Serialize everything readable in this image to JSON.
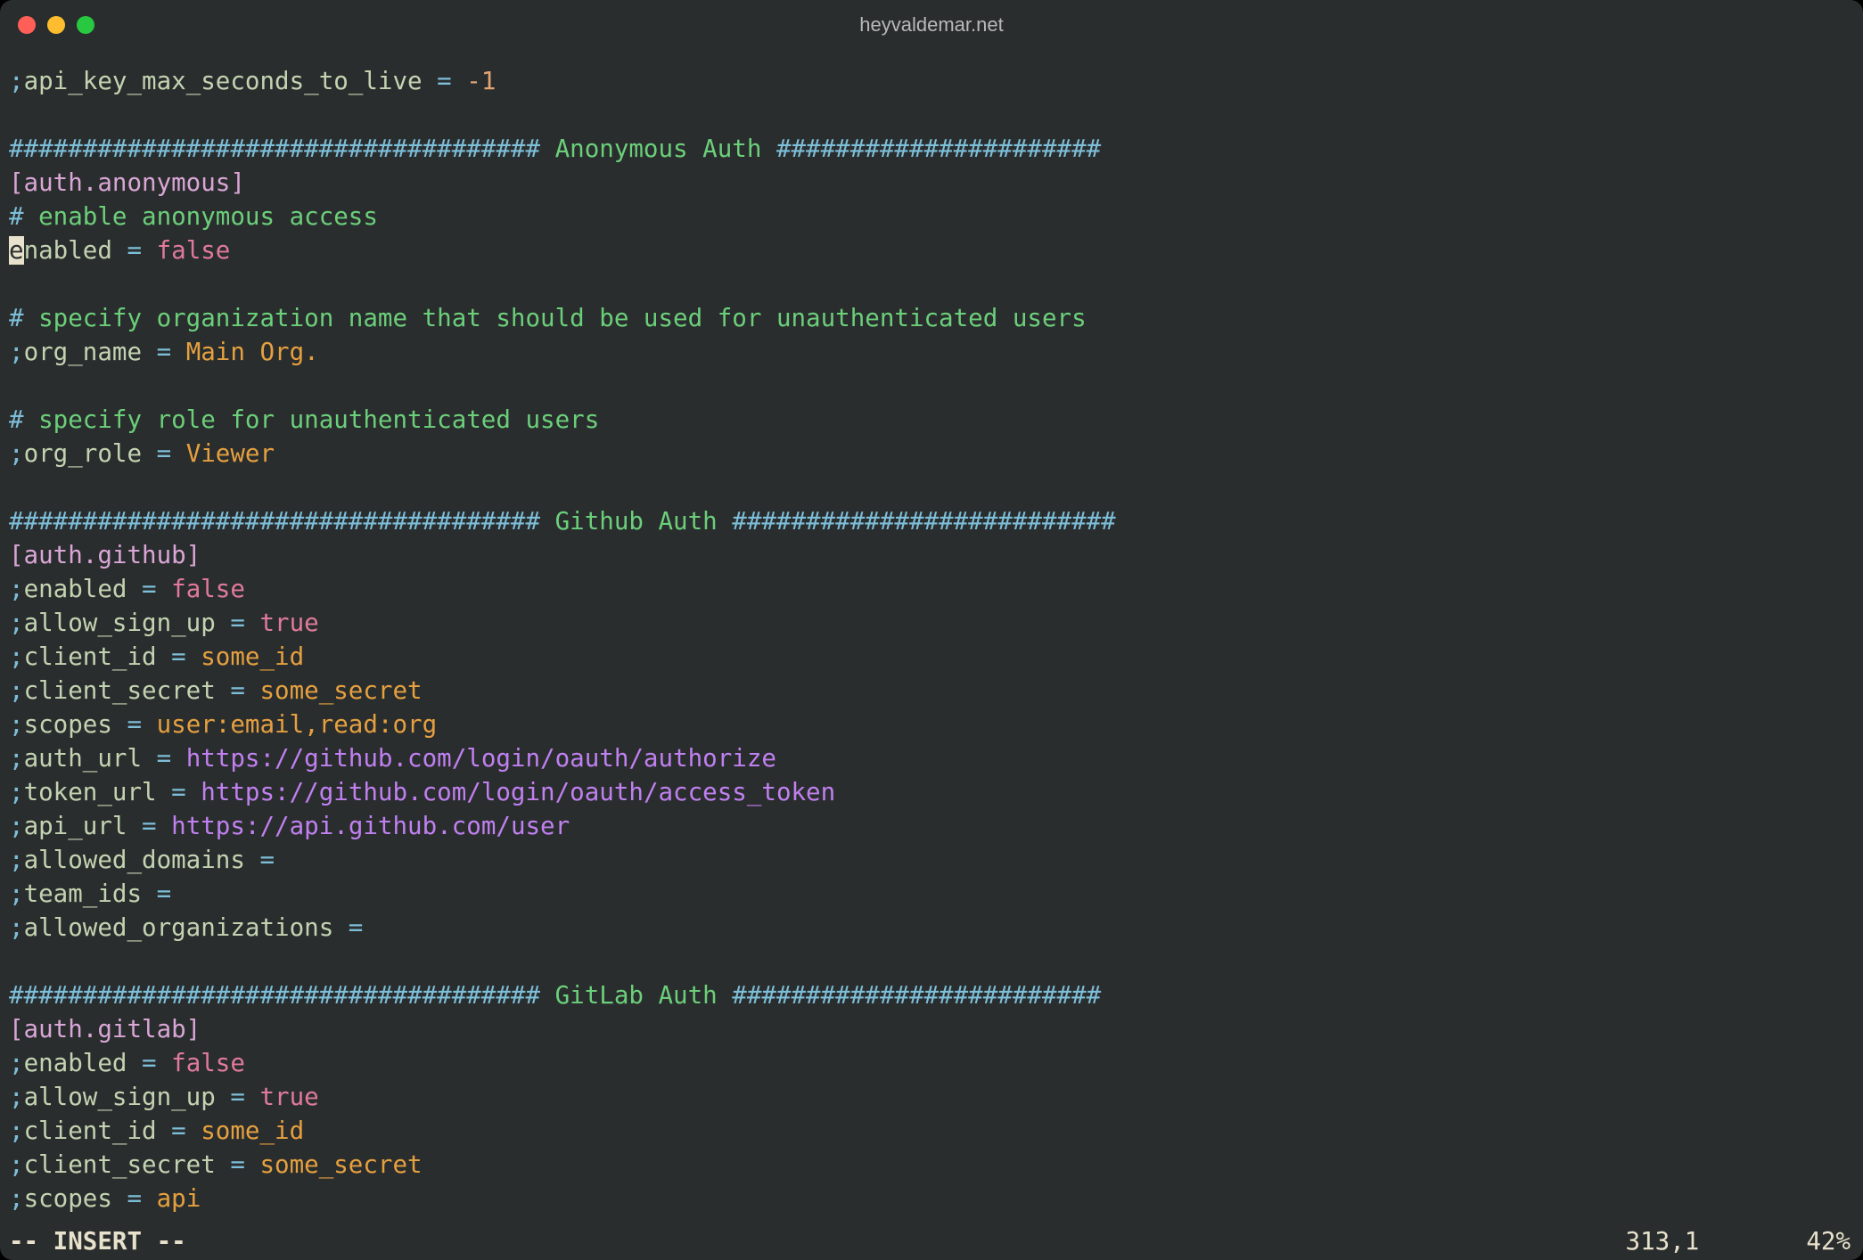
{
  "window": {
    "title": "heyvaldemar.net"
  },
  "editor": {
    "cursor_line_index": 5,
    "cursor_col": 0,
    "lines": [
      {
        "text": ";api_key_max_seconds_to_live = -1"
      },
      {
        "text": ""
      },
      {
        "text": "#################################### Anonymous Auth ######################"
      },
      {
        "text": "[auth.anonymous]"
      },
      {
        "text": "# enable anonymous access"
      },
      {
        "text": "enabled = false"
      },
      {
        "text": ""
      },
      {
        "text": "# specify organization name that should be used for unauthenticated users"
      },
      {
        "text": ";org_name = Main Org."
      },
      {
        "text": ""
      },
      {
        "text": "# specify role for unauthenticated users"
      },
      {
        "text": ";org_role = Viewer"
      },
      {
        "text": ""
      },
      {
        "text": "#################################### Github Auth ##########################"
      },
      {
        "text": "[auth.github]"
      },
      {
        "text": ";enabled = false"
      },
      {
        "text": ";allow_sign_up = true"
      },
      {
        "text": ";client_id = some_id"
      },
      {
        "text": ";client_secret = some_secret"
      },
      {
        "text": ";scopes = user:email,read:org"
      },
      {
        "text": ";auth_url = https://github.com/login/oauth/authorize"
      },
      {
        "text": ";token_url = https://github.com/login/oauth/access_token"
      },
      {
        "text": ";api_url = https://api.github.com/user"
      },
      {
        "text": ";allowed_domains ="
      },
      {
        "text": ";team_ids ="
      },
      {
        "text": ";allowed_organizations ="
      },
      {
        "text": ""
      },
      {
        "text": "#################################### GitLab Auth #########################"
      },
      {
        "text": "[auth.gitlab]"
      },
      {
        "text": ";enabled = false"
      },
      {
        "text": ";allow_sign_up = true"
      },
      {
        "text": ";client_id = some_id"
      },
      {
        "text": ";client_secret = some_secret"
      },
      {
        "text": ";scopes = api"
      }
    ]
  },
  "status": {
    "mode": "-- INSERT --",
    "position": "313,1",
    "percent": "42%"
  }
}
